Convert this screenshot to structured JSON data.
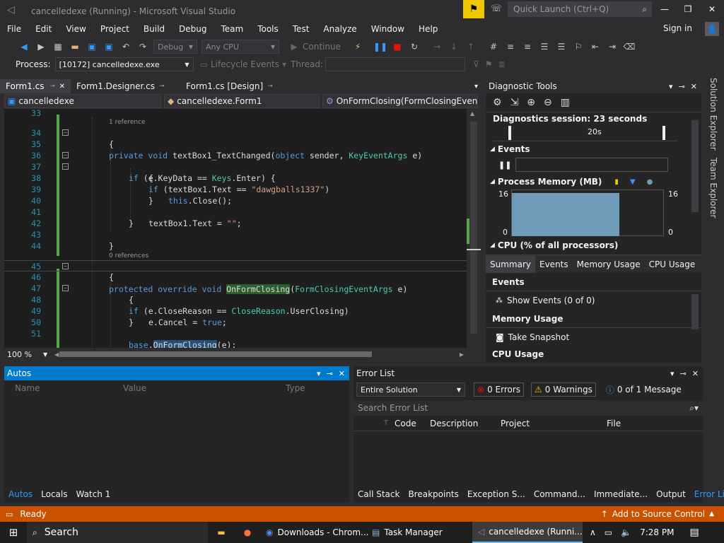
{
  "title": "cancelledexe (Running) - Microsoft Visual Studio",
  "quick_launch": {
    "placeholder": "Quick Launch (Ctrl+Q)"
  },
  "menu": [
    "File",
    "Edit",
    "View",
    "Project",
    "Build",
    "Debug",
    "Team",
    "Tools",
    "Test",
    "Analyze",
    "Window",
    "Help"
  ],
  "sign_in": "Sign in",
  "toolbar": {
    "config": "Debug",
    "platform": "Any CPU",
    "continue": "Continue"
  },
  "procbar": {
    "process_label": "Process:",
    "process_value": "[10172] cancelledexe.exe",
    "lifecycle": "Lifecycle Events",
    "thread_label": "Thread:"
  },
  "doc_tabs": [
    {
      "label": "Form1.cs",
      "active": true
    },
    {
      "label": "Form1.Designer.cs"
    },
    {
      "label": "Form1.cs [Design]"
    }
  ],
  "nav": {
    "project": "cancelledexe",
    "class": "cancelledexe.Form1",
    "member": "OnFormClosing(FormClosingEvent"
  },
  "zoom": "100 %",
  "code": {
    "lens_34": "1 reference",
    "lens_45": "0 references",
    "lines": [
      {
        "n": "33",
        "text": ""
      },
      {
        "n": "34",
        "text": ""
      },
      {
        "n": "35",
        "text": "{"
      },
      {
        "n": "36",
        "text": ""
      },
      {
        "n": "37",
        "text": ""
      },
      {
        "n": "38",
        "text": "{"
      },
      {
        "n": "39",
        "text": ""
      },
      {
        "n": "40",
        "text": "}"
      },
      {
        "n": "41",
        "text": ""
      },
      {
        "n": "42",
        "text": "}"
      },
      {
        "n": "43",
        "text": ""
      },
      {
        "n": "44",
        "text": "}"
      },
      {
        "n": "45",
        "text": ""
      },
      {
        "n": "46",
        "text": "{"
      },
      {
        "n": "47",
        "text": ""
      },
      {
        "n": "48",
        "text": "{"
      },
      {
        "n": "49",
        "text": ""
      },
      {
        "n": "50",
        "text": "}"
      },
      {
        "n": "51",
        "text": ""
      }
    ],
    "l34": {
      "a": "private void ",
      "b": "textBox1_TextChanged",
      "c": "(",
      "d": "object",
      "e": " sender, ",
      "f": "KeyEventArgs",
      "g": " e)"
    },
    "l36": {
      "a": "if",
      "b": " (e.KeyData == ",
      "c": "Keys",
      "d": ".Enter) {"
    },
    "l37": {
      "a": "if",
      "b": " (textBox1.Text == ",
      "c": "\"dawgballs1337\"",
      "d": ")"
    },
    "l39": {
      "a": "this",
      "b": ".Close();"
    },
    "l41": {
      "a": "textBox1.Text = ",
      "b": "\"\"",
      "c": ";"
    },
    "l45": {
      "a": "protected override void ",
      "b": "OnFormClosing",
      "c": "(",
      "d": "FormClosingEventArgs",
      "e": " e)"
    },
    "l47": {
      "a": "if",
      "b": " (e.CloseReason == ",
      "c": "CloseReason",
      "d": ".UserClosing)"
    },
    "l49": {
      "a": "e.Cancel = ",
      "b": "true",
      "c": ";"
    },
    "l51": {
      "a": "base",
      "b": ".",
      "c": "OnFormClosing",
      "d": "(e);"
    }
  },
  "diag": {
    "title": "Diagnostic Tools",
    "session": "Diagnostics session: 23 seconds",
    "timeline_label": "20s",
    "events": "Events",
    "memory_title": "Process Memory (MB)",
    "mem_max_left": "16",
    "mem_min_left": "0",
    "mem_max_right": "16",
    "mem_min_right": "0",
    "cpu_title": "CPU (% of all processors)",
    "tabs": [
      "Summary",
      "Events",
      "Memory Usage",
      "CPU Usage"
    ],
    "sum_events": "Events",
    "show_events": "Show Events (0 of 0)",
    "sum_memory": "Memory Usage",
    "take_snapshot": "Take Snapshot",
    "sum_cpu": "CPU Usage"
  },
  "side": [
    "Solution Explorer",
    "Team Explorer"
  ],
  "autos": {
    "title": "Autos",
    "cols": [
      "Name",
      "Value",
      "Type"
    ],
    "tabs": [
      "Autos",
      "Locals",
      "Watch 1"
    ]
  },
  "errors": {
    "title": "Error List",
    "scope": "Entire Solution",
    "errors": "0 Errors",
    "warnings": "0 Warnings",
    "messages": "0 of 1 Message",
    "search": "Search Error List",
    "cols": [
      "Code",
      "Description",
      "Project",
      "File"
    ],
    "tabs": [
      "Call Stack",
      "Breakpoints",
      "Exception S...",
      "Command...",
      "Immediate...",
      "Output",
      "Error List"
    ]
  },
  "status": {
    "ready": "Ready",
    "source_control": "Add to Source Control"
  },
  "taskbar": {
    "search": "Search",
    "items": [
      "Downloads - Chrom...",
      "Task Manager",
      "cancelledexe (Runni..."
    ],
    "time": "7:28 PM"
  }
}
